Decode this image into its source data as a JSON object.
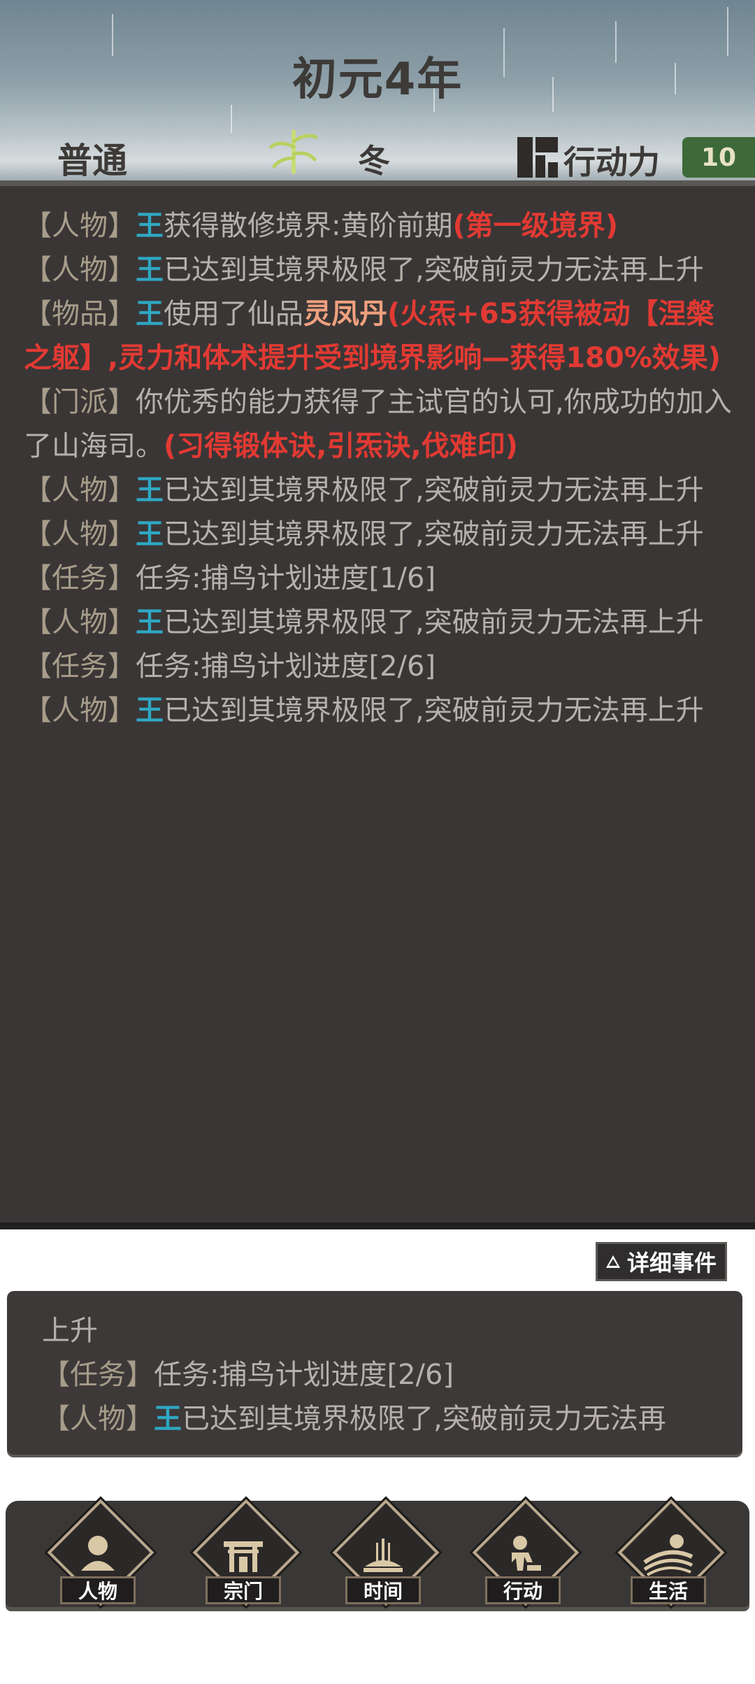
{
  "header": {
    "year": "初元4年",
    "difficulty": "普通",
    "season": "冬",
    "action_points_label": "行动力",
    "action_points_value": "10"
  },
  "log": {
    "entries": [
      {
        "tag": "【人物】",
        "name": "王",
        "text": "获得散修境界:黄阶前期",
        "highlight": "(第一级境界)"
      },
      {
        "tag": "【人物】",
        "name": "王",
        "text": "已达到其境界极限了,突破前灵力无法再上升"
      },
      {
        "tag": "【物品】",
        "name": "王",
        "text": "使用了仙品",
        "item": "灵凤丹",
        "highlight": "(火炁+65获得被动【涅槃之躯】,灵力和体术提升受到境界影响—获得180%效果)"
      },
      {
        "tag": "【门派】",
        "text": "你优秀的能力获得了主试官的认可,你成功的加入了山海司。",
        "highlight": "(习得锻体诀,引炁诀,伐难印)"
      },
      {
        "tag": "【人物】",
        "name": "王",
        "text": "已达到其境界极限了,突破前灵力无法再上升"
      },
      {
        "tag": "【人物】",
        "name": "王",
        "text": "已达到其境界极限了,突破前灵力无法再上升"
      },
      {
        "tag": "【任务】",
        "text": "任务:捕鸟计划进度[1/6]"
      },
      {
        "tag": "【人物】",
        "name": "王",
        "text": "已达到其境界极限了,突破前灵力无法再上升"
      },
      {
        "tag": "【任务】",
        "text": "任务:捕鸟计划进度[2/6]"
      },
      {
        "tag": "【人物】",
        "name": "王",
        "text": "已达到其境界极限了,突破前灵力无法再上升"
      }
    ]
  },
  "detail_button": {
    "label": "详细事件"
  },
  "mini_log": {
    "line1": "上升",
    "line2_tag": "【任务】",
    "line2_text": "任务:捕鸟计划进度[2/6]",
    "line3_tag": "【人物】",
    "line3_name": "王",
    "line3_text": "已达到其境界极限了,突破前灵力无法再"
  },
  "nav": {
    "items": [
      {
        "label": "人物",
        "icon": "person-icon"
      },
      {
        "label": "宗门",
        "icon": "gate-icon"
      },
      {
        "label": "时间",
        "icon": "incense-icon"
      },
      {
        "label": "行动",
        "icon": "action-icon"
      },
      {
        "label": "生活",
        "icon": "life-icon"
      }
    ]
  },
  "colors": {
    "log_bg": "#3a3636",
    "name": "#2fa8c4",
    "highlight": "#e23a33",
    "item": "#f0a07e",
    "tag": "#a79d8a"
  }
}
